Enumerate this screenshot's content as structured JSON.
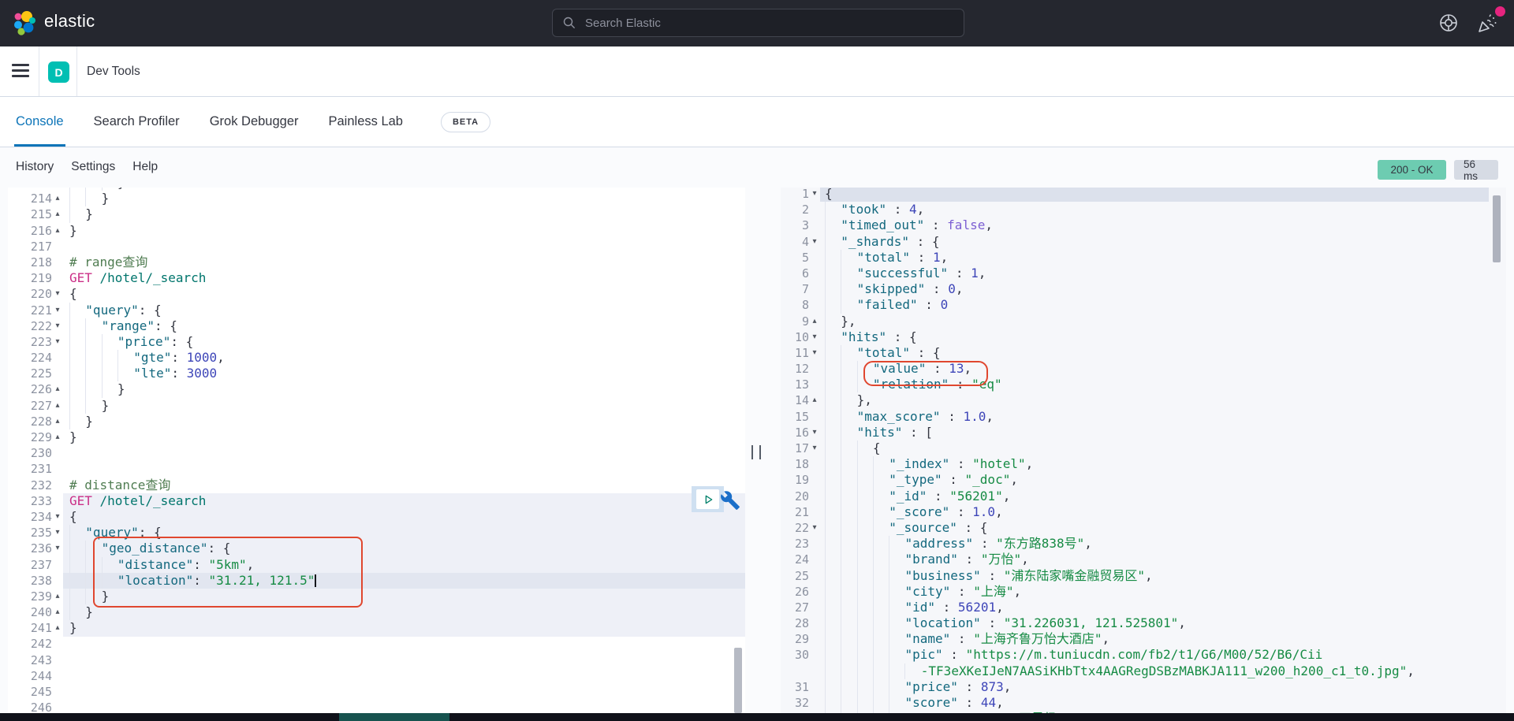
{
  "header": {
    "brand": "elastic",
    "search_placeholder": "Search Elastic",
    "icons": [
      "search-icon",
      "help-icon",
      "newsfeed-icon"
    ]
  },
  "breadcrumb": {
    "app_initial": "D",
    "title": "Dev Tools",
    "icons": [
      "menu-icon"
    ]
  },
  "tabs": [
    {
      "label": "Console",
      "active": true
    },
    {
      "label": "Search Profiler",
      "active": false
    },
    {
      "label": "Grok Debugger",
      "active": false
    },
    {
      "label": "Painless Lab",
      "active": false,
      "beta": "BETA"
    }
  ],
  "toolbar": {
    "links": [
      "History",
      "Settings",
      "Help"
    ],
    "status_badge": "200 - OK",
    "time_badge": "56 ms"
  },
  "colors": {
    "header-bg": "#25272f",
    "accent": "#00bfb3",
    "tab-active": "#0c74b8",
    "badge-ok": "#6dccb1",
    "badge-time": "#d6dbe4",
    "annotation": "#e0472f",
    "tok-k": "#13687e",
    "tok-s": "#168b44",
    "tok-n": "#3d45b8",
    "tok-b": "#7c5fd3",
    "tok-p": "#343741",
    "tok-c": "#507d52",
    "tok-m": "#cb2f87",
    "tok-u": "#00756c"
  },
  "left_editor": {
    "lines": [
      {
        "n": 213,
        "i": 3,
        "t": [
          [
            "p",
            "}"
          ]
        ]
      },
      {
        "n": 214,
        "f": "u",
        "i": 2,
        "t": [
          [
            "p",
            "}"
          ]
        ]
      },
      {
        "n": 215,
        "f": "u",
        "i": 1,
        "t": [
          [
            "p",
            "}"
          ]
        ]
      },
      {
        "n": 216,
        "f": "u",
        "i": 0,
        "t": [
          [
            "p",
            "}"
          ]
        ]
      },
      {
        "n": 217,
        "t": []
      },
      {
        "n": 218,
        "t": [
          [
            "c",
            "# range查询"
          ]
        ]
      },
      {
        "n": 219,
        "t": [
          [
            "m",
            "GET"
          ],
          [
            "u",
            " /hotel/_search"
          ]
        ]
      },
      {
        "n": 220,
        "f": "d",
        "t": [
          [
            "p",
            "{"
          ]
        ]
      },
      {
        "n": 221,
        "f": "d",
        "i": 1,
        "t": [
          [
            "k",
            "\"query\""
          ],
          [
            "p",
            ": {"
          ]
        ]
      },
      {
        "n": 222,
        "f": "d",
        "i": 2,
        "t": [
          [
            "k",
            "\"range\""
          ],
          [
            "p",
            ": {"
          ]
        ]
      },
      {
        "n": 223,
        "f": "d",
        "i": 3,
        "t": [
          [
            "k",
            "\"price\""
          ],
          [
            "p",
            ": {"
          ]
        ]
      },
      {
        "n": 224,
        "i": 4,
        "t": [
          [
            "k",
            "\"gte\""
          ],
          [
            "p",
            ": "
          ],
          [
            "n2",
            "1000"
          ],
          [
            "p",
            ","
          ]
        ]
      },
      {
        "n": 225,
        "i": 4,
        "t": [
          [
            "k",
            "\"lte\""
          ],
          [
            "p",
            ": "
          ],
          [
            "n2",
            "3000"
          ]
        ]
      },
      {
        "n": 226,
        "f": "u",
        "i": 3,
        "t": [
          [
            "p",
            "}"
          ]
        ]
      },
      {
        "n": 227,
        "f": "u",
        "i": 2,
        "t": [
          [
            "p",
            "}"
          ]
        ]
      },
      {
        "n": 228,
        "f": "u",
        "i": 1,
        "t": [
          [
            "p",
            "}"
          ]
        ]
      },
      {
        "n": 229,
        "f": "u",
        "i": 0,
        "t": [
          [
            "p",
            "}"
          ]
        ]
      },
      {
        "n": 230,
        "t": []
      },
      {
        "n": 231,
        "t": []
      },
      {
        "n": 232,
        "t": [
          [
            "c",
            "# distance查询"
          ]
        ]
      },
      {
        "n": 233,
        "t": [
          [
            "m",
            "GET"
          ],
          [
            "u",
            " /hotel/_search"
          ]
        ]
      },
      {
        "n": 234,
        "f": "d",
        "t": [
          [
            "p",
            "{"
          ]
        ]
      },
      {
        "n": 235,
        "f": "d",
        "i": 1,
        "t": [
          [
            "k",
            "\"query\""
          ],
          [
            "p",
            ": {"
          ]
        ]
      },
      {
        "n": 236,
        "f": "d",
        "i": 2,
        "t": [
          [
            "k",
            "\"geo_distance\""
          ],
          [
            "p",
            ": {"
          ]
        ]
      },
      {
        "n": 237,
        "i": 3,
        "t": [
          [
            "k",
            "\"distance\""
          ],
          [
            "p",
            ": "
          ],
          [
            "s",
            "\"5km\""
          ],
          [
            "p",
            ","
          ]
        ]
      },
      {
        "n": 238,
        "i": 3,
        "cur": true,
        "t": [
          [
            "k",
            "\"location\""
          ],
          [
            "p",
            ": "
          ],
          [
            "s",
            "\"31.21, 121.5\""
          ]
        ]
      },
      {
        "n": 239,
        "f": "u",
        "i": 2,
        "t": [
          [
            "p",
            "}"
          ]
        ]
      },
      {
        "n": 240,
        "f": "u",
        "i": 1,
        "t": [
          [
            "p",
            "}"
          ]
        ]
      },
      {
        "n": 241,
        "f": "u",
        "i": 0,
        "t": [
          [
            "p",
            "}"
          ]
        ]
      },
      {
        "n": 242,
        "t": []
      },
      {
        "n": 243,
        "t": []
      },
      {
        "n": 244,
        "t": []
      },
      {
        "n": 245,
        "t": []
      },
      {
        "n": 246,
        "t": []
      }
    ]
  },
  "right_editor": {
    "lines": [
      {
        "n": 1,
        "f": "d",
        "t": [
          [
            "p",
            "{"
          ]
        ]
      },
      {
        "n": 2,
        "i": 1,
        "t": [
          [
            "k",
            "\"took\""
          ],
          [
            "p",
            " : "
          ],
          [
            "n2",
            "4"
          ],
          [
            "p",
            ","
          ]
        ]
      },
      {
        "n": 3,
        "i": 1,
        "t": [
          [
            "k",
            "\"timed_out\""
          ],
          [
            "p",
            " : "
          ],
          [
            "b",
            "false"
          ],
          [
            "p",
            ","
          ]
        ]
      },
      {
        "n": 4,
        "f": "d",
        "i": 1,
        "t": [
          [
            "k",
            "\"_shards\""
          ],
          [
            "p",
            " : {"
          ]
        ]
      },
      {
        "n": 5,
        "i": 2,
        "t": [
          [
            "k",
            "\"total\""
          ],
          [
            "p",
            " : "
          ],
          [
            "n2",
            "1"
          ],
          [
            "p",
            ","
          ]
        ]
      },
      {
        "n": 6,
        "i": 2,
        "t": [
          [
            "k",
            "\"successful\""
          ],
          [
            "p",
            " : "
          ],
          [
            "n2",
            "1"
          ],
          [
            "p",
            ","
          ]
        ]
      },
      {
        "n": 7,
        "i": 2,
        "t": [
          [
            "k",
            "\"skipped\""
          ],
          [
            "p",
            " : "
          ],
          [
            "n2",
            "0"
          ],
          [
            "p",
            ","
          ]
        ]
      },
      {
        "n": 8,
        "i": 2,
        "t": [
          [
            "k",
            "\"failed\""
          ],
          [
            "p",
            " : "
          ],
          [
            "n2",
            "0"
          ]
        ]
      },
      {
        "n": 9,
        "f": "u",
        "i": 1,
        "t": [
          [
            "p",
            "},"
          ]
        ]
      },
      {
        "n": 10,
        "f": "d",
        "i": 1,
        "t": [
          [
            "k",
            "\"hits\""
          ],
          [
            "p",
            " : {"
          ]
        ]
      },
      {
        "n": 11,
        "f": "d",
        "i": 2,
        "t": [
          [
            "k",
            "\"total\""
          ],
          [
            "p",
            " : {"
          ]
        ]
      },
      {
        "n": 12,
        "i": 3,
        "t": [
          [
            "k",
            "\"value\""
          ],
          [
            "p",
            " : "
          ],
          [
            "n2",
            "13"
          ],
          [
            "p",
            ","
          ]
        ]
      },
      {
        "n": 13,
        "i": 3,
        "t": [
          [
            "k",
            "\"relation\""
          ],
          [
            "p",
            " : "
          ],
          [
            "s",
            "\"eq\""
          ]
        ]
      },
      {
        "n": 14,
        "f": "u",
        "i": 2,
        "t": [
          [
            "p",
            "},"
          ]
        ]
      },
      {
        "n": 15,
        "i": 2,
        "t": [
          [
            "k",
            "\"max_score\""
          ],
          [
            "p",
            " : "
          ],
          [
            "n2",
            "1.0"
          ],
          [
            "p",
            ","
          ]
        ]
      },
      {
        "n": 16,
        "f": "d",
        "i": 2,
        "t": [
          [
            "k",
            "\"hits\""
          ],
          [
            "p",
            " : ["
          ]
        ]
      },
      {
        "n": 17,
        "f": "d",
        "i": 3,
        "t": [
          [
            "p",
            "{"
          ]
        ]
      },
      {
        "n": 18,
        "i": 4,
        "t": [
          [
            "k",
            "\"_index\""
          ],
          [
            "p",
            " : "
          ],
          [
            "s",
            "\"hotel\""
          ],
          [
            "p",
            ","
          ]
        ]
      },
      {
        "n": 19,
        "i": 4,
        "t": [
          [
            "k",
            "\"_type\""
          ],
          [
            "p",
            " : "
          ],
          [
            "s",
            "\"_doc\""
          ],
          [
            "p",
            ","
          ]
        ]
      },
      {
        "n": 20,
        "i": 4,
        "t": [
          [
            "k",
            "\"_id\""
          ],
          [
            "p",
            " : "
          ],
          [
            "s",
            "\"56201\""
          ],
          [
            "p",
            ","
          ]
        ]
      },
      {
        "n": 21,
        "i": 4,
        "t": [
          [
            "k",
            "\"_score\""
          ],
          [
            "p",
            " : "
          ],
          [
            "n2",
            "1.0"
          ],
          [
            "p",
            ","
          ]
        ]
      },
      {
        "n": 22,
        "f": "d",
        "i": 4,
        "t": [
          [
            "k",
            "\"_source\""
          ],
          [
            "p",
            " : {"
          ]
        ]
      },
      {
        "n": 23,
        "i": 5,
        "t": [
          [
            "k",
            "\"address\""
          ],
          [
            "p",
            " : "
          ],
          [
            "s",
            "\"东方路838号\""
          ],
          [
            "p",
            ","
          ]
        ]
      },
      {
        "n": 24,
        "i": 5,
        "t": [
          [
            "k",
            "\"brand\""
          ],
          [
            "p",
            " : "
          ],
          [
            "s",
            "\"万怡\""
          ],
          [
            "p",
            ","
          ]
        ]
      },
      {
        "n": 25,
        "i": 5,
        "t": [
          [
            "k",
            "\"business\""
          ],
          [
            "p",
            " : "
          ],
          [
            "s",
            "\"浦东陆家嘴金融贸易区\""
          ],
          [
            "p",
            ","
          ]
        ]
      },
      {
        "n": 26,
        "i": 5,
        "t": [
          [
            "k",
            "\"city\""
          ],
          [
            "p",
            " : "
          ],
          [
            "s",
            "\"上海\""
          ],
          [
            "p",
            ","
          ]
        ]
      },
      {
        "n": 27,
        "i": 5,
        "t": [
          [
            "k",
            "\"id\""
          ],
          [
            "p",
            " : "
          ],
          [
            "n2",
            "56201"
          ],
          [
            "p",
            ","
          ]
        ]
      },
      {
        "n": 28,
        "i": 5,
        "t": [
          [
            "k",
            "\"location\""
          ],
          [
            "p",
            " : "
          ],
          [
            "s",
            "\"31.226031, 121.525801\""
          ],
          [
            "p",
            ","
          ]
        ]
      },
      {
        "n": 29,
        "i": 5,
        "t": [
          [
            "k",
            "\"name\""
          ],
          [
            "p",
            " : "
          ],
          [
            "s",
            "\"上海齐鲁万怡大酒店\""
          ],
          [
            "p",
            ","
          ]
        ]
      },
      {
        "n": 30,
        "i": 5,
        "t": [
          [
            "k",
            "\"pic\""
          ],
          [
            "p",
            " : "
          ],
          [
            "s",
            "\"https://m.tuniucdn.com/fb2/t1/G6/M00/52/B6/Cii"
          ]
        ]
      },
      {
        "w": true,
        "i": 6,
        "t": [
          [
            "s",
            "-TF3eXKeIJeN7AASiKHbTtx4AAGRegDSBzMABKJA111_w200_h200_c1_t0.jpg\""
          ],
          [
            "p",
            ","
          ]
        ]
      },
      {
        "n": 31,
        "i": 5,
        "t": [
          [
            "k",
            "\"price\""
          ],
          [
            "p",
            " : "
          ],
          [
            "n2",
            "873"
          ],
          [
            "p",
            ","
          ]
        ]
      },
      {
        "n": 32,
        "i": 5,
        "t": [
          [
            "k",
            "\"score\""
          ],
          [
            "p",
            " : "
          ],
          [
            "n2",
            "44"
          ],
          [
            "p",
            ","
          ]
        ]
      },
      {
        "n": 33,
        "i": 5,
        "t": [
          [
            "k",
            "\"star_name\""
          ],
          [
            "p",
            " : "
          ],
          [
            "s",
            "\"四星级\""
          ]
        ]
      }
    ]
  }
}
